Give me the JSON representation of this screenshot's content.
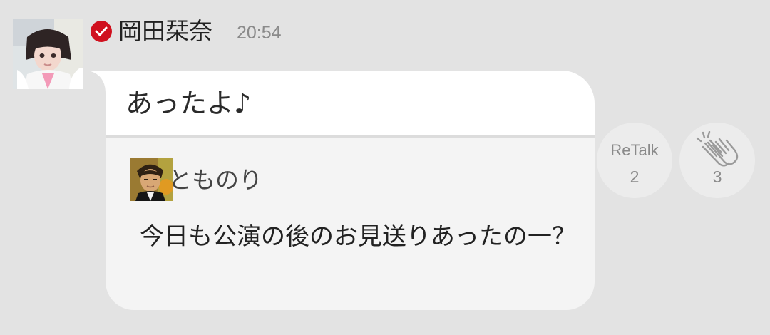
{
  "message": {
    "sender_name": "岡田栞奈",
    "timestamp": "20:54",
    "text": "あったよ♪",
    "quoted": {
      "name": "とものり",
      "text": "今日も公演の後のお見送りあったの一？"
    }
  },
  "actions": {
    "retalk": {
      "label": "ReTalk",
      "count": "2"
    },
    "clap": {
      "count": "3"
    }
  },
  "colors": {
    "background": "#e3e3e3",
    "verified_badge": "#d0101e",
    "bubble_top": "#ffffff",
    "bubble_bottom": "#f4f4f4",
    "action_circle": "#ececec"
  },
  "icons": {
    "verified": "verified-check-icon",
    "clap": "clapping-hands-icon"
  }
}
